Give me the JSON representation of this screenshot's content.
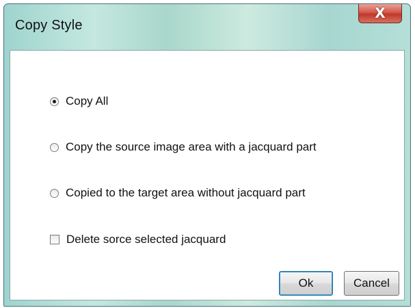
{
  "window": {
    "title": "Copy Style",
    "close_glyph": "X"
  },
  "options": [
    {
      "type": "radio",
      "label": "Copy All",
      "checked": true
    },
    {
      "type": "radio",
      "label": "Copy the source image area with a jacquard part",
      "checked": false
    },
    {
      "type": "radio",
      "label": "Copied to the target area without jacquard part",
      "checked": false
    },
    {
      "type": "checkbox",
      "label": "Delete sorce selected jacquard",
      "checked": false
    }
  ],
  "buttons": {
    "ok_label": "Ok",
    "cancel_label": "Cancel"
  },
  "colors": {
    "title_gradient": "#a9d7cb",
    "close_button": "#c0392b",
    "client_background": "#ffffff"
  },
  "icons": {
    "close": "close-icon"
  }
}
